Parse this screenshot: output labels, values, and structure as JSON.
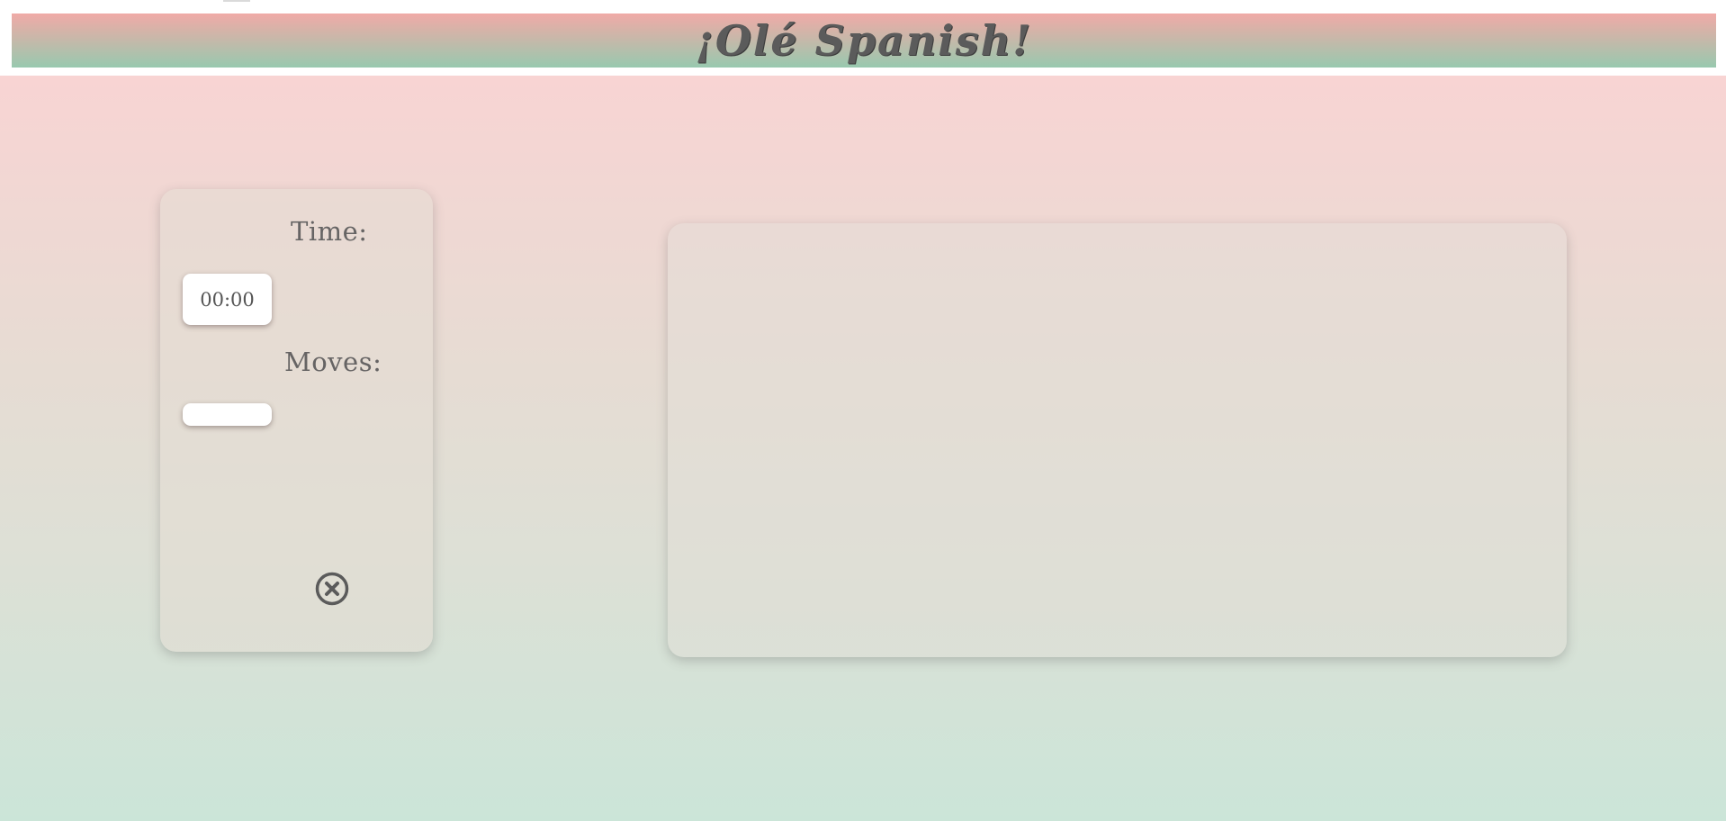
{
  "header": {
    "title": "¡Olé Spanish!"
  },
  "stats_panel": {
    "time_label": "Time:",
    "time_value": "00:00",
    "moves_label": "Moves:",
    "moves_value": "",
    "close_icon": "circle-x-icon"
  },
  "colors": {
    "header_top": "#f0aaa7",
    "header_bottom": "#98c9af",
    "background_top": "#f8d4d3",
    "background_bottom": "#cbe5d8",
    "text": "#5b5b5b"
  }
}
